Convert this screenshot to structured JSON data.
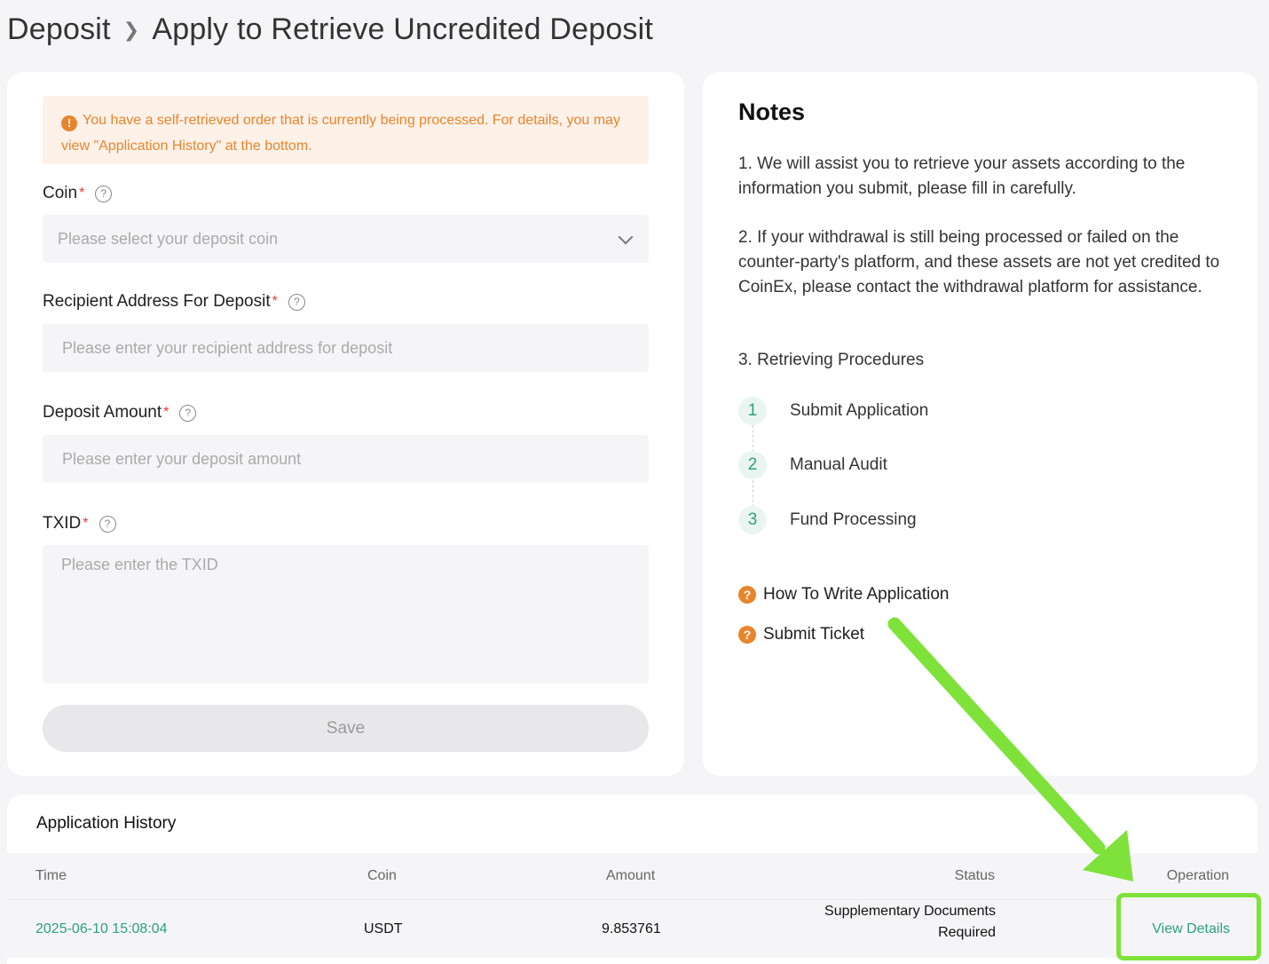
{
  "breadcrumb": {
    "parent": "Deposit",
    "current": "Apply to Retrieve Uncredited Deposit"
  },
  "alert": {
    "icon": "warning-icon",
    "text": "You have a self-retrieved order that is currently being processed. For details, you may view \"Application History\" at the bottom."
  },
  "form": {
    "coin": {
      "label": "Coin",
      "required": "*",
      "placeholder": "Please select your deposit coin"
    },
    "address": {
      "label": "Recipient Address For Deposit",
      "required": "*",
      "placeholder": "Please enter your recipient address for deposit"
    },
    "amount": {
      "label": "Deposit Amount",
      "required": "*",
      "placeholder": "Please enter your deposit amount"
    },
    "txid": {
      "label": "TXID",
      "required": "*",
      "placeholder": "Please enter the TXID"
    },
    "save_label": "Save",
    "help_glyph": "?"
  },
  "notes": {
    "title": "Notes",
    "p1": "1. We will assist you to retrieve your assets according to the information you submit, please fill in carefully.",
    "p2": "2. If your withdrawal is still being processed or failed on the counter-party's platform, and these assets are not yet credited to CoinEx, please contact the withdrawal platform for assistance.",
    "p3": "3. Retrieving Procedures",
    "steps": [
      {
        "num": "1",
        "label": "Submit Application"
      },
      {
        "num": "2",
        "label": "Manual Audit"
      },
      {
        "num": "3",
        "label": "Fund Processing"
      }
    ],
    "links": [
      {
        "label": "How To Write Application",
        "icon": "question-icon"
      },
      {
        "label": "Submit Ticket",
        "icon": "question-icon"
      }
    ],
    "q_glyph": "?"
  },
  "history": {
    "title": "Application History",
    "columns": [
      "Time",
      "Coin",
      "Amount",
      "Status",
      "Operation"
    ],
    "rows": [
      {
        "time": "2025-06-10 15:08:04",
        "coin": "USDT",
        "amount": "9.853761",
        "status_line1": "Supplementary Documents",
        "status_line2": "Required",
        "operation": "View Details"
      }
    ]
  },
  "colors": {
    "accent_green": "#2ca17a",
    "warning_orange": "#e8852c",
    "required_red": "#e53935",
    "annotation_green": "#7ee23a"
  }
}
